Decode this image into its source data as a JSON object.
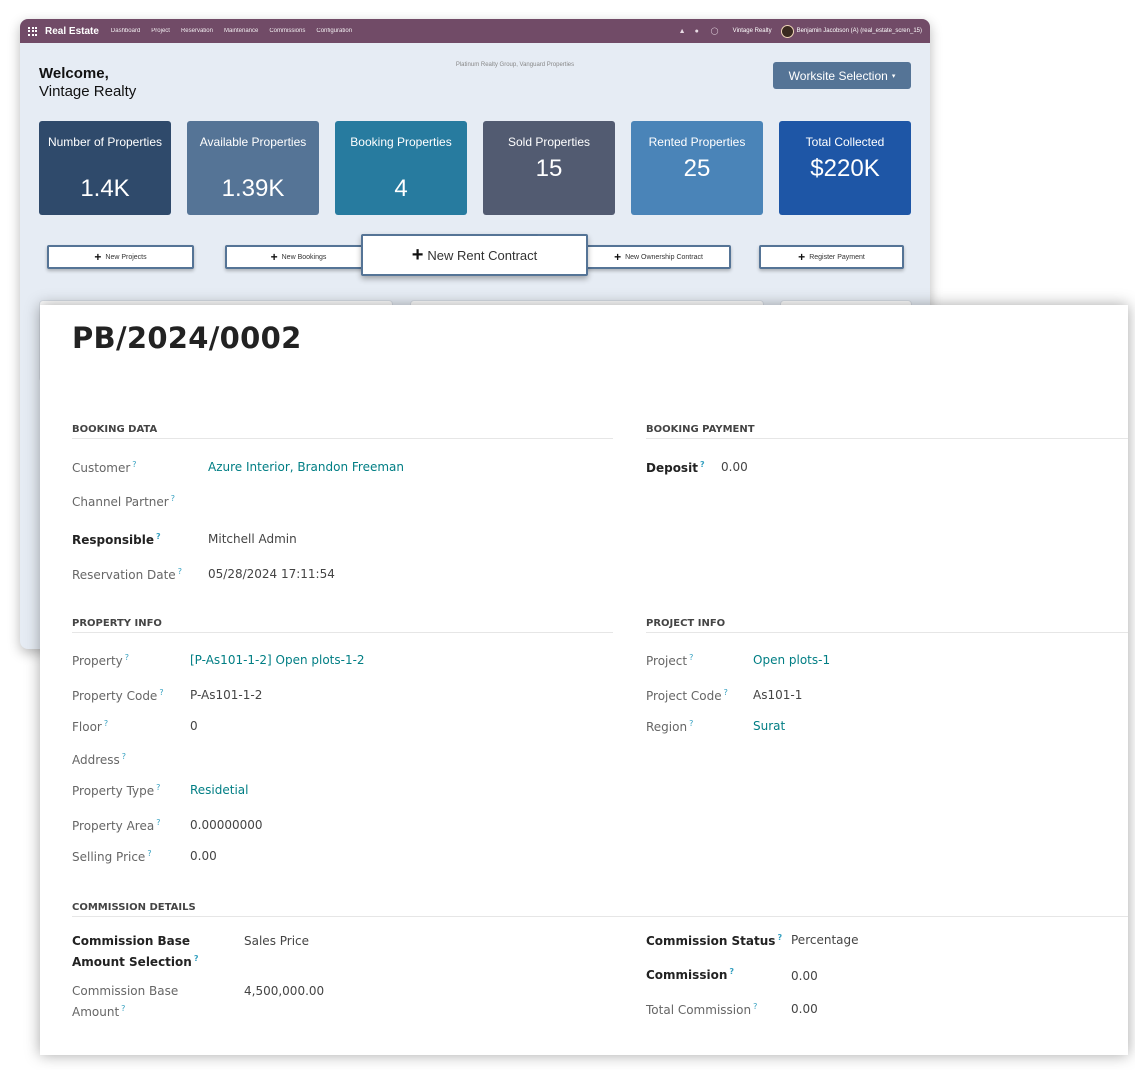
{
  "dashboard": {
    "navbar": {
      "brand": "Real Estate",
      "menu": [
        "Dashboard",
        "Project",
        "Reservation",
        "Maintenance",
        "Commissions",
        "Configuration"
      ],
      "company": "Vintage Realty",
      "user": "Benjamin Jacobson (A) (real_estate_scren_15)",
      "icons": [
        "gift-icon",
        "chat-icon",
        "clock-icon"
      ]
    },
    "welcome_line1": "Welcome,",
    "welcome_line2": "Vintage Realty",
    "companies": "Platinum Realty Group, Vanguard Properties",
    "worksite_button": "Worksite Selection",
    "kpis": [
      {
        "label": "Number of Properties",
        "value": "1.4K",
        "color": "#2f4a6b"
      },
      {
        "label": "Available Properties",
        "value": "1.39K",
        "color": "#557496"
      },
      {
        "label": "Booking Properties",
        "value": "4",
        "color": "#277b9f"
      },
      {
        "label": "Sold Properties",
        "value": "15",
        "color": "#525b71"
      },
      {
        "label": "Rented Properties",
        "value": "25",
        "color": "#4a84b8"
      },
      {
        "label": "Total Collected",
        "value": "$220K",
        "color": "#1e56a6"
      }
    ],
    "actions": [
      "New Projects",
      "New Bookings",
      "New Rent Contract",
      "New Ownership Contract",
      "Register Payment"
    ]
  },
  "form": {
    "title": "PB/2024/0002",
    "booking_data": {
      "header": "BOOKING DATA",
      "customer_label": "Customer",
      "customer": "Azure Interior, Brandon Freeman",
      "channel_partner_label": "Channel Partner",
      "channel_partner": "",
      "responsible_label": "Responsible",
      "responsible": "Mitchell Admin",
      "reservation_date_label": "Reservation Date",
      "reservation_date": "05/28/2024 17:11:54"
    },
    "booking_payment": {
      "header": "BOOKING PAYMENT",
      "deposit_label": "Deposit",
      "deposit": "0.00"
    },
    "property_info": {
      "header": "PROPERTY INFO",
      "property_label": "Property",
      "property": "[P-As101-1-2] Open plots-1-2",
      "property_code_label": "Property Code",
      "property_code": "P-As101-1-2",
      "floor_label": "Floor",
      "floor": "0",
      "address_label": "Address",
      "address": "",
      "property_type_label": "Property Type",
      "property_type": "Residetial",
      "property_area_label": "Property Area",
      "property_area": "0.00000000",
      "selling_price_label": "Selling Price",
      "selling_price": "0.00"
    },
    "project_info": {
      "header": "PROJECT INFO",
      "project_label": "Project",
      "project": "Open plots-1",
      "project_code_label": "Project Code",
      "project_code": "As101-1",
      "region_label": "Region",
      "region": "Surat"
    },
    "commission_details": {
      "header": "COMMISSION DETAILS",
      "base_selection_label_1": "Commission Base",
      "base_selection_label_2": "Amount Selection",
      "base_selection": "Sales Price",
      "base_amount_label_1": "Commission Base",
      "base_amount_label_2": "Amount",
      "base_amount": "4,500,000.00",
      "status_label": "Commission Status",
      "status": "Percentage",
      "commission_label": "Commission",
      "commission": "0.00",
      "total_label": "Total Commission",
      "total": "0.00"
    },
    "help_marker": "?"
  }
}
